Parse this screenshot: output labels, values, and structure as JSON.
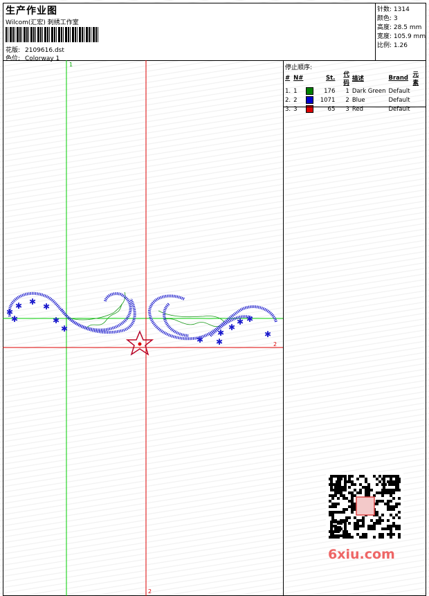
{
  "header": {
    "title": "生产作业图",
    "subtitle": "Wilcom(汇宏) 刺绣工作室",
    "design_label": "花版:",
    "design_value": "2109616.dst",
    "colorway_label": "色位:",
    "colorway_value": "Colorway 1"
  },
  "stats": [
    {
      "label": "针数:",
      "value": "1314"
    },
    {
      "label": "颜色:",
      "value": "3"
    },
    {
      "label": "高度:",
      "value": "28.5 mm"
    },
    {
      "label": "宽度:",
      "value": "105.9 mm"
    },
    {
      "label": "比例:",
      "value": "1.26"
    }
  ],
  "stop_sequence": {
    "heading": "停止顺序:",
    "columns": [
      "#",
      "N#",
      "St.",
      "代码",
      "描述",
      "Brand",
      "元素"
    ],
    "rows": [
      {
        "num": "1.",
        "n": "1",
        "color": "#008000",
        "st": "176",
        "code": "1",
        "desc": "Dark Green",
        "brand": "Default"
      },
      {
        "num": "2.",
        "n": "2",
        "color": "#0000cc",
        "st": "1071",
        "code": "2",
        "desc": "Blue",
        "brand": "Default"
      },
      {
        "num": "3.",
        "n": "3",
        "color": "#dd0000",
        "st": "65",
        "code": "3",
        "desc": "Red",
        "brand": "Default"
      }
    ]
  },
  "axis_labels": {
    "green_top": "1",
    "red_bottom": "2",
    "red_right": "2"
  },
  "watermark": "6xiu.com",
  "colors": {
    "green_guide": "#00cc00",
    "red_guide": "#dd0000",
    "blue_stitch": "#1a1acc",
    "green_stitch": "#1a9a1a"
  }
}
